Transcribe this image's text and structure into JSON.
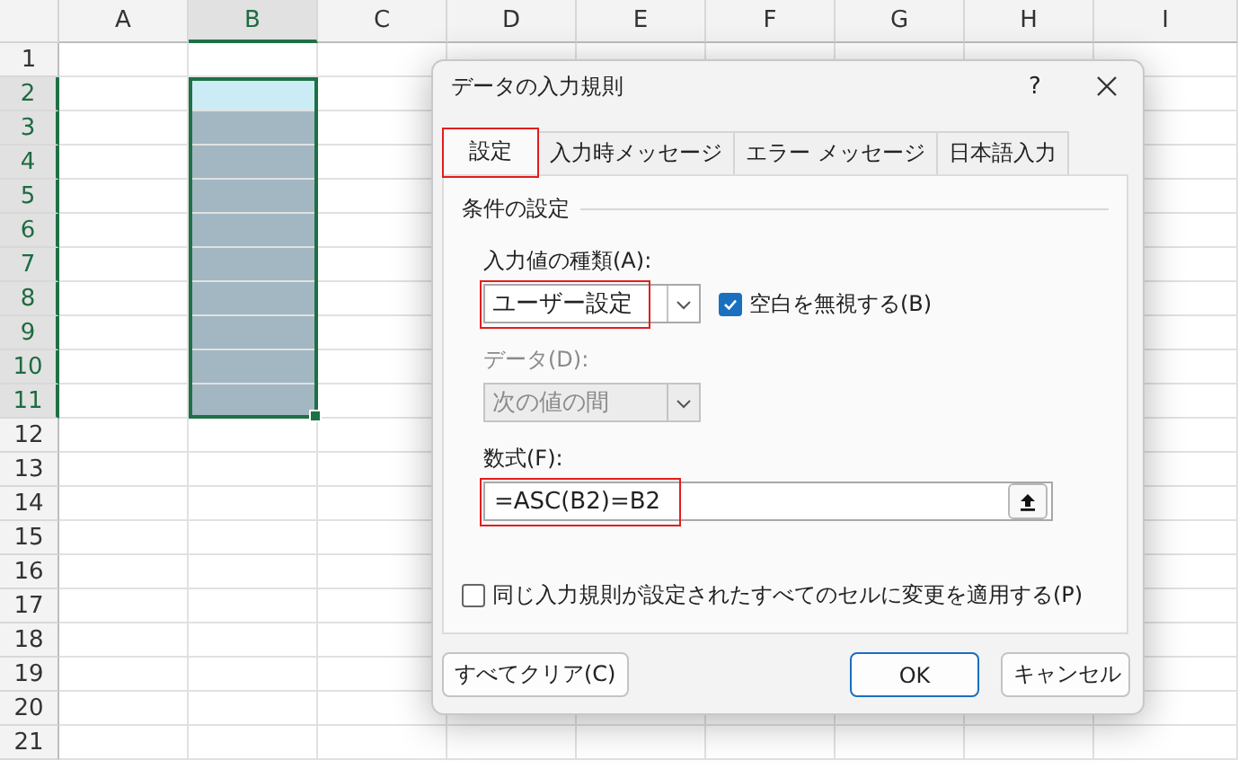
{
  "sheet": {
    "columns": [
      {
        "label": "A",
        "selected": false
      },
      {
        "label": "B",
        "selected": true
      },
      {
        "label": "C",
        "selected": false
      },
      {
        "label": "D",
        "selected": false
      },
      {
        "label": "E",
        "selected": false
      },
      {
        "label": "F",
        "selected": false
      },
      {
        "label": "G",
        "selected": false
      },
      {
        "label": "H",
        "selected": false
      },
      {
        "label": "I",
        "selected": false
      }
    ],
    "rows": [
      {
        "label": "1",
        "selected": false
      },
      {
        "label": "2",
        "selected": true
      },
      {
        "label": "3",
        "selected": true
      },
      {
        "label": "4",
        "selected": true
      },
      {
        "label": "5",
        "selected": true
      },
      {
        "label": "6",
        "selected": true
      },
      {
        "label": "7",
        "selected": true
      },
      {
        "label": "8",
        "selected": true
      },
      {
        "label": "9",
        "selected": true
      },
      {
        "label": "10",
        "selected": true
      },
      {
        "label": "11",
        "selected": true
      },
      {
        "label": "12",
        "selected": false
      },
      {
        "label": "13",
        "selected": false
      },
      {
        "label": "14",
        "selected": false
      },
      {
        "label": "15",
        "selected": false
      },
      {
        "label": "16",
        "selected": false
      },
      {
        "label": "17",
        "selected": false
      },
      {
        "label": "18",
        "selected": false
      },
      {
        "label": "19",
        "selected": false
      },
      {
        "label": "20",
        "selected": false
      },
      {
        "label": "21",
        "selected": false
      }
    ]
  },
  "dialog": {
    "title": "データの入力規則",
    "help": "?",
    "tabs": [
      {
        "label": "設定",
        "selected": true,
        "highlighted": true
      },
      {
        "label": "入力時メッセージ",
        "selected": false,
        "highlighted": false
      },
      {
        "label": "エラー メッセージ",
        "selected": false,
        "highlighted": false
      },
      {
        "label": "日本語入力",
        "selected": false,
        "highlighted": false
      }
    ],
    "group_title": "条件の設定",
    "allow": {
      "label": "入力値の種類(A):",
      "value": "ユーザー設定",
      "highlighted": true,
      "disabled": false
    },
    "ignore_blank": {
      "label": "空白を無視する(B)",
      "checked": true
    },
    "data": {
      "label": "データ(D):",
      "value": "次の値の間",
      "highlighted": false,
      "disabled": true
    },
    "formula": {
      "label": "数式(F):",
      "value": "=ASC(B2)=B2",
      "highlighted": true
    },
    "apply_all": {
      "label": "同じ入力規則が設定されたすべてのセルに変更を適用する(P)",
      "checked": false
    },
    "buttons": [
      {
        "label": "すべてクリア(C)",
        "default": false
      },
      {
        "label": "OK",
        "default": true
      },
      {
        "label": "キャンセル",
        "default": false
      }
    ]
  }
}
